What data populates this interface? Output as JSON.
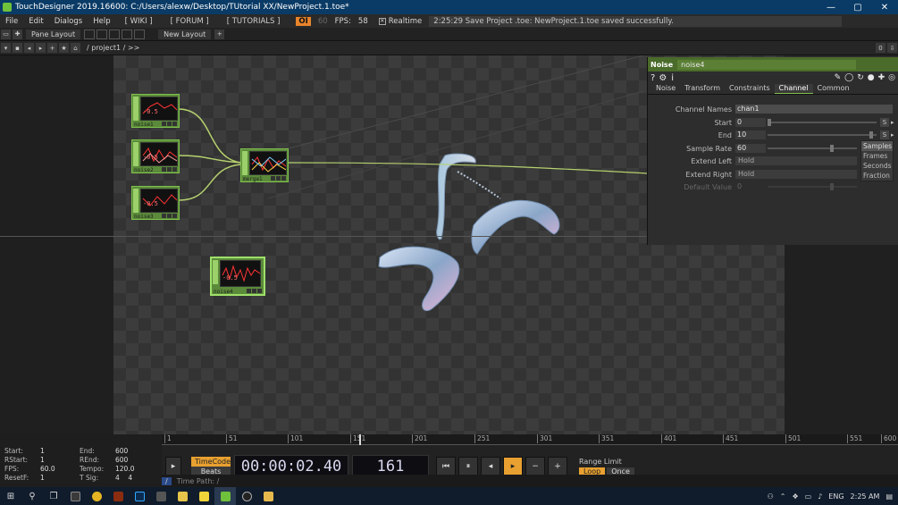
{
  "window": {
    "title": "TouchDesigner 2019.16600: C:/Users/alexw/Desktop/TUtorial XX/NewProject.1.toe*",
    "minimize": "—",
    "maximize": "▢",
    "close": "✕"
  },
  "menu": {
    "items": [
      "File",
      "Edit",
      "Dialogs",
      "Help"
    ],
    "links": [
      "[ WIKI ]",
      "[ FORUM ]",
      "[ TUTORIALS ]"
    ],
    "badge": "OI",
    "fps_target": "60",
    "fps_label": "FPS:",
    "fps_value": "58",
    "realtime_label": "Realtime",
    "status": "2:25:29 Save Project .toe: NewProject.1.toe saved successfully."
  },
  "pane": {
    "pane_layout": "Pane Layout",
    "new_layout": "New Layout",
    "add": "+"
  },
  "path": {
    "current": "/ project1 / >>",
    "zero": "0"
  },
  "nodes": [
    {
      "name": "noise1",
      "value": "-0.5"
    },
    {
      "name": "noise2",
      "value": "-0.5"
    },
    {
      "name": "noise3",
      "value": "-0.5"
    },
    {
      "name": "merge1",
      "value": ""
    },
    {
      "name": "noise4",
      "value": "-0.5"
    }
  ],
  "params": {
    "op_type": "Noise",
    "op_name": "noise4",
    "tabs": [
      "Noise",
      "Transform",
      "Constraints",
      "Channel",
      "Common"
    ],
    "active_tab": "Channel",
    "channel_names_label": "Channel Names",
    "channel_names": "chan1",
    "start_label": "Start",
    "start": "0",
    "end_label": "End",
    "end": "10",
    "sample_rate_label": "Sample Rate",
    "sample_rate": "60",
    "extend_left_label": "Extend Left",
    "extend_left": "Hold",
    "extend_right_label": "Extend Right",
    "extend_right": "Hold",
    "default_value_label": "Default Value",
    "default_value": "0",
    "unit_btn": "S",
    "unit_options": [
      "Samples",
      "Frames",
      "Seconds",
      "Fraction"
    ]
  },
  "timeline": {
    "info": {
      "start_label": "Start:",
      "start": "1",
      "end_label": "End:",
      "end": "600",
      "rstart_label": "RStart:",
      "rstart": "1",
      "rend_label": "REnd:",
      "rend": "600",
      "fps_label": "FPS:",
      "fps": "60.0",
      "tempo_label": "Tempo:",
      "tempo": "120.0",
      "resetf_label": "ResetF:",
      "resetf": "1",
      "tsig_label": "T Sig:",
      "tsig_a": "4",
      "tsig_b": "4"
    },
    "ticks": [
      "1",
      "51",
      "101",
      "151",
      "201",
      "251",
      "301",
      "351",
      "401",
      "451",
      "501",
      "551",
      "600"
    ],
    "timecode_label": "TimeCode",
    "beats_label": "Beats",
    "timecode": "00:00:02.40",
    "frame": "161",
    "range_limit": "Range Limit",
    "loop": "Loop",
    "once": "Once",
    "time_path": "Time Path: /"
  },
  "taskbar": {
    "lang": "ENG",
    "clock": "2:25 AM"
  },
  "colors": {
    "node_green": "#5b8a3a",
    "accent_orange": "#e8a030",
    "titlebar": "#0a3b66"
  }
}
